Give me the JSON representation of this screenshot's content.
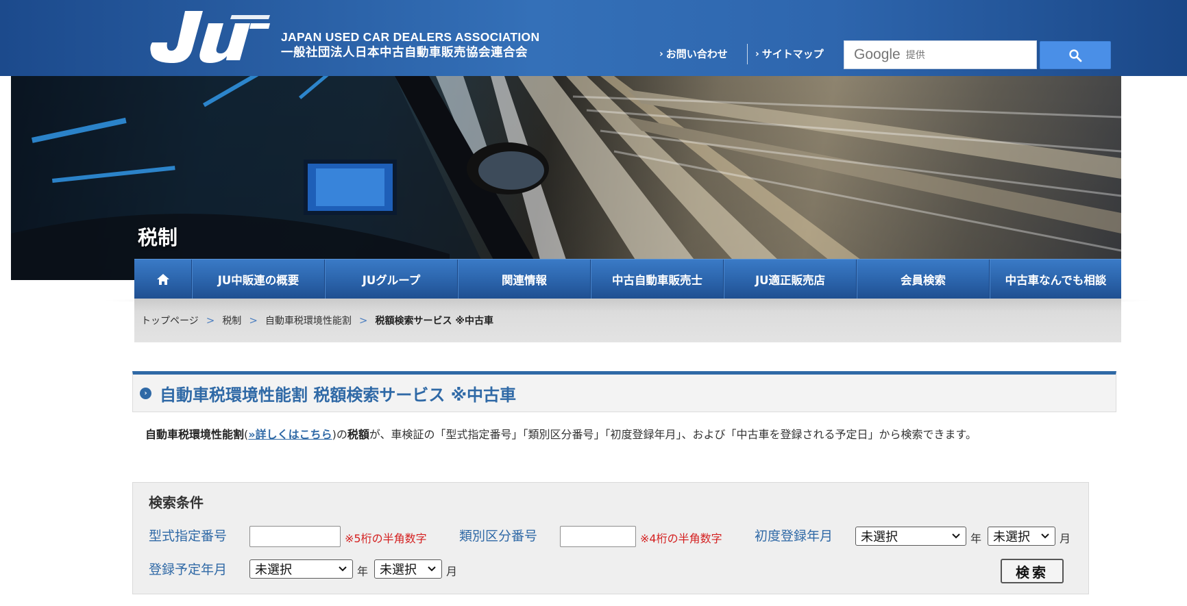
{
  "header": {
    "org_name_en": "JAPAN USED CAR DEALERS ASSOCIATION",
    "org_name_ja": "一般社団法人日本中古自動車販売協会連合会",
    "links": [
      {
        "label": "お問い合わせ"
      },
      {
        "label": "サイトマップ"
      }
    ],
    "search": {
      "brand": "Google",
      "brand_sub": "提供"
    }
  },
  "hero": {
    "title": "税制"
  },
  "gnav": {
    "items": [
      {
        "label": "JU中販連の概要"
      },
      {
        "label": "JUグループ"
      },
      {
        "label": "関連情報"
      },
      {
        "label": "中古自動車販売士"
      },
      {
        "label": "JU適正販売店"
      },
      {
        "label": "会員検索"
      },
      {
        "label": "中古車なんでも相談"
      }
    ]
  },
  "breadcrumb": {
    "items": [
      "トップページ",
      "税制",
      "自動車税環境性能割"
    ],
    "current": "税額検索サービス ※中古車",
    "separator": ">"
  },
  "section": {
    "title": "自動車税環境性能割 税額検索サービス ※中古車"
  },
  "description": {
    "part1": "自動車税環境性能割",
    "paren_open": "(",
    "link": "»詳しくはこちら",
    "paren_close": ")の",
    "part2": "税額",
    "part3": "が、車検証の「型式指定番号」「類別区分番号」「初度登録年月」、および「中古車を登録される予定日」から検索できます。"
  },
  "search_panel": {
    "title": "検索条件",
    "model_code": {
      "label": "型式指定番号",
      "value": "",
      "note": "※5桁の半角数字"
    },
    "class_code": {
      "label": "類別区分番号",
      "value": "",
      "note": "※4桁の半角数字"
    },
    "first_reg": {
      "label": "初度登録年月",
      "year": "未選択",
      "year_unit": "年",
      "month": "未選択",
      "month_unit": "月"
    },
    "planned_reg": {
      "label": "登録予定年月",
      "year": "未選択",
      "year_unit": "年",
      "month": "未選択",
      "month_unit": "月"
    },
    "submit": "検索"
  },
  "colors": {
    "header_blue": "#2e66ae",
    "nav_blue": "#2b64ab",
    "heading_blue": "#2f69a6",
    "note_red": "#d42020",
    "search_button": "#4a8fe7"
  },
  "icons": [
    "home-icon",
    "search-icon",
    "chevron-right-icon",
    "circle-chevron-icon",
    "dropdown-caret-icon"
  ]
}
